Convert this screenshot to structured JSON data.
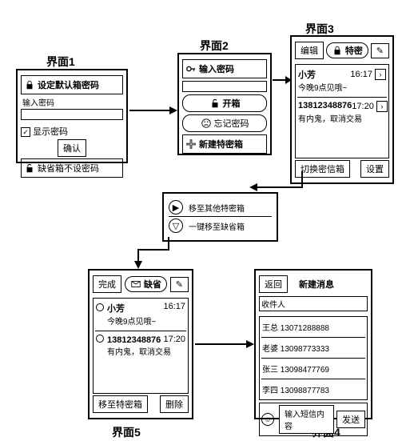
{
  "labels": {
    "s1": "界面1",
    "s2": "界面2",
    "s3": "界面3",
    "s4": "界面4",
    "s5": "界面5"
  },
  "s1": {
    "title": "设定默认箱密码",
    "pw_label": "输入密码",
    "show_pw": "显示密码",
    "confirm": "确认",
    "skip": "缺省箱不设密码"
  },
  "s2": {
    "title": "输入密码",
    "open": "开箱",
    "forgot": "忘记密码",
    "create": "新建特密箱"
  },
  "s3": {
    "edit": "编辑",
    "secret": "特密",
    "compose": "✎",
    "m1_name": "小芳",
    "m1_body": "今晚9点见哦~",
    "m1_time": "16:17",
    "m2_name": "13812348876",
    "m2_body": "有内鬼，取消交易",
    "m2_time": "17:20",
    "switch": "切换密信箱",
    "settings": "设置"
  },
  "popup": {
    "move": "移至其他特密箱",
    "quick": "一键移至缺省箱"
  },
  "s5": {
    "done": "完成",
    "default": "缺省",
    "compose": "✎",
    "m1_name": "小芳",
    "m1_body": "今晚9点见哦~",
    "m1_time": "16:17",
    "m2_name": "13812348876",
    "m2_body": "有内鬼，取消交易",
    "m2_time": "17:20",
    "move": "移至特密箱",
    "delete": "删除"
  },
  "s4": {
    "back": "返回",
    "title": "新建消息",
    "recipient": "收件人",
    "c1": "王总 13071288888",
    "c2": "老婆 13098773333",
    "c3": "张三 13098477769",
    "c4": "李四 13098877783",
    "input_hint": "输入短信内容",
    "send": "发送"
  }
}
